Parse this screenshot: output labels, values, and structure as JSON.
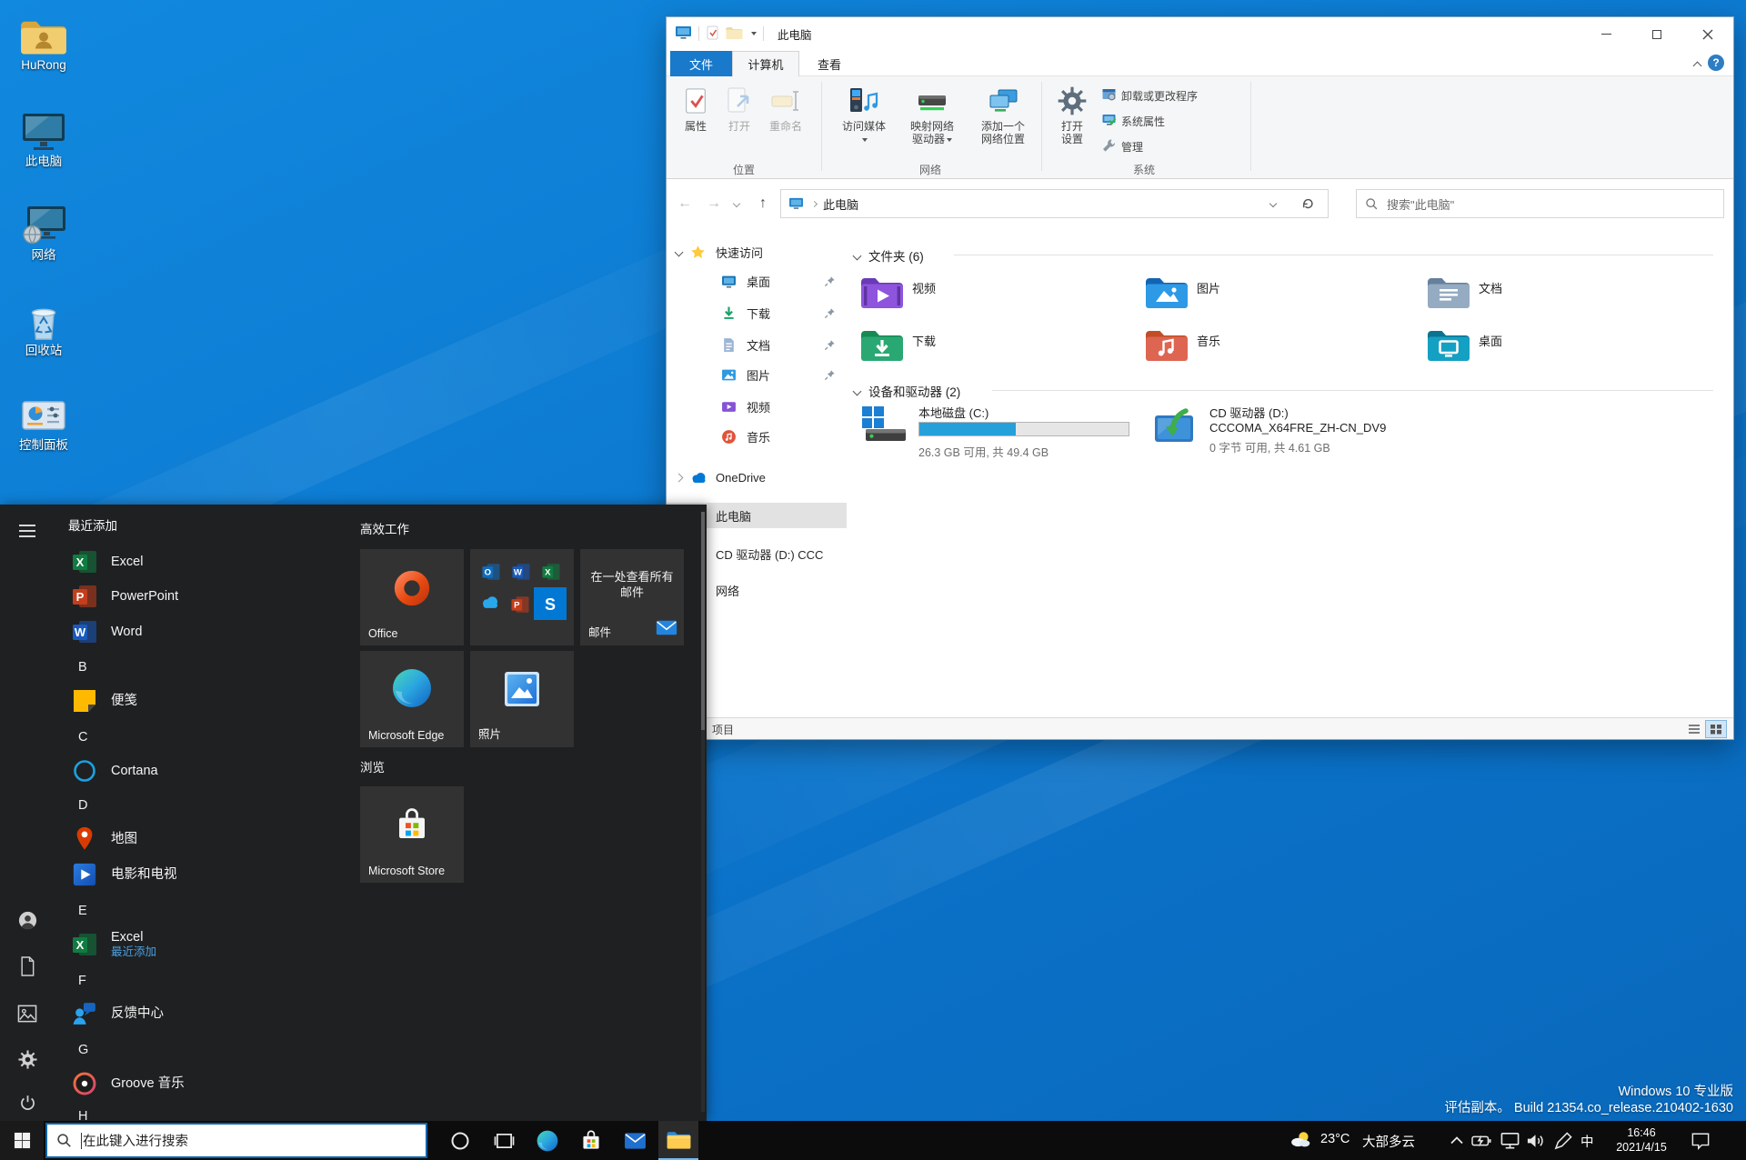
{
  "colors": {
    "accent": "#0078d7",
    "taskbar": "#0c0c0d",
    "start_menu_bg": "#1f2022",
    "file_tab": "#1979ca",
    "drive_bar_fill": "#26a0da",
    "selected_nav": "#e2e2e2"
  },
  "desktop": {
    "icons": [
      {
        "label": "HuRong",
        "icon": "user-folder-icon"
      },
      {
        "label": "此电脑",
        "icon": "this-pc-icon"
      },
      {
        "label": "网络",
        "icon": "network-icon"
      },
      {
        "label": "回收站",
        "icon": "recycle-bin-icon"
      },
      {
        "label": "控制面板",
        "icon": "control-panel-icon"
      }
    ],
    "version_line1": "Windows 10 专业版",
    "version_line2": "评估副本。  Build 21354.co_release.210402-1630"
  },
  "explorer": {
    "title": "此电脑",
    "tabs": [
      {
        "label": "文件"
      },
      {
        "label": "计算机",
        "active": true
      },
      {
        "label": "查看"
      }
    ],
    "ribbon": {
      "properties": "属性",
      "open": "打开",
      "rename": "重命名",
      "access_media": "访问媒体",
      "map_drive_l1": "映射网络",
      "map_drive_l2": "驱动器",
      "add_location_l1": "添加一个",
      "add_location_l2": "网络位置",
      "open_settings_l1": "打开",
      "open_settings_l2": "设置",
      "uninstall": "卸载或更改程序",
      "sys_props": "系统属性",
      "manage": "管理",
      "groups": [
        "位置",
        "网络",
        "系统"
      ]
    },
    "address": {
      "path": "此电脑",
      "search_placeholder": "搜索\"此电脑\""
    },
    "nav": [
      {
        "label": "快速访问"
      },
      {
        "label": "桌面"
      },
      {
        "label": "下载"
      },
      {
        "label": "文档"
      },
      {
        "label": "图片"
      },
      {
        "label": "视频"
      },
      {
        "label": "音乐"
      },
      {
        "label": "OneDrive"
      },
      {
        "label": "此电脑"
      },
      {
        "label": "CD 驱动器 (D:) CCC"
      },
      {
        "label": "网络"
      }
    ],
    "main": {
      "section1": "文件夹 (6)",
      "folders": [
        {
          "label": "视频",
          "icon": "video-folder-icon",
          "back": "#6a3ab8",
          "front": "#8e54de"
        },
        {
          "label": "图片",
          "icon": "pictures-folder-icon",
          "back": "#1464b4",
          "front": "#2e9ae6"
        },
        {
          "label": "文档",
          "icon": "documents-folder-icon",
          "back": "#64809b",
          "front": "#94abc2"
        },
        {
          "label": "下载",
          "icon": "downloads-folder-icon",
          "back": "#168a52",
          "front": "#2aa873"
        },
        {
          "label": "音乐",
          "icon": "music-folder-icon",
          "back": "#c14f23",
          "front": "#de6552"
        },
        {
          "label": "桌面",
          "icon": "desktop-folder-icon",
          "back": "#0a7390",
          "front": "#14a0c2"
        }
      ],
      "section2": "设备和驱动器 (2)",
      "drives": [
        {
          "name": "本地磁盘 (C:)",
          "info": "26.3 GB 可用, 共 49.4 GB",
          "bar_pct": 46
        },
        {
          "name": "CD 驱动器 (D:)",
          "name2": "CCCOMA_X64FRE_ZH-CN_DV9",
          "info": "0 字节 可用, 共 4.61 GB"
        }
      ]
    },
    "status": "项目"
  },
  "start_menu": {
    "headers": {
      "recent": "最近添加",
      "productivity": "高效工作",
      "explore": "浏览"
    },
    "apps": [
      {
        "kind": "header",
        "label": "最近添加"
      },
      {
        "kind": "app",
        "label": "Excel",
        "icon": "excel-icon"
      },
      {
        "kind": "app",
        "label": "PowerPoint",
        "icon": "powerpoint-icon"
      },
      {
        "kind": "app",
        "label": "Word",
        "icon": "word-icon"
      },
      {
        "kind": "letter",
        "label": "B"
      },
      {
        "kind": "app",
        "label": "便笺",
        "icon": "sticky-notes-icon"
      },
      {
        "kind": "letter",
        "label": "C"
      },
      {
        "kind": "app",
        "label": "Cortana",
        "icon": "cortana-icon"
      },
      {
        "kind": "letter",
        "label": "D"
      },
      {
        "kind": "app",
        "label": "地图",
        "icon": "maps-icon"
      },
      {
        "kind": "app",
        "label": "电影和电视",
        "icon": "movies-tv-icon"
      },
      {
        "kind": "letter",
        "label": "E"
      },
      {
        "kind": "app",
        "label": "Excel",
        "sublabel": "最近添加",
        "icon": "excel-icon"
      },
      {
        "kind": "letter",
        "label": "F"
      },
      {
        "kind": "app",
        "label": "反馈中心",
        "icon": "feedback-hub-icon"
      },
      {
        "kind": "letter",
        "label": "G"
      },
      {
        "kind": "app",
        "label": "Groove 音乐",
        "icon": "groove-music-icon"
      },
      {
        "kind": "letter",
        "label": "H"
      }
    ],
    "tiles": {
      "office_label": "Office",
      "mail_text": "在一处查看所有邮件",
      "mail_label": "邮件",
      "edge_label": "Microsoft Edge",
      "photos_label": "照片",
      "store_label": "Microsoft Store"
    }
  },
  "taskbar": {
    "search_placeholder": "在此键入进行搜索",
    "tray": {
      "weather_temp": "23°C",
      "weather_desc": "大部多云",
      "ime": "中",
      "time": "16:46",
      "date": "2021/4/15"
    }
  }
}
